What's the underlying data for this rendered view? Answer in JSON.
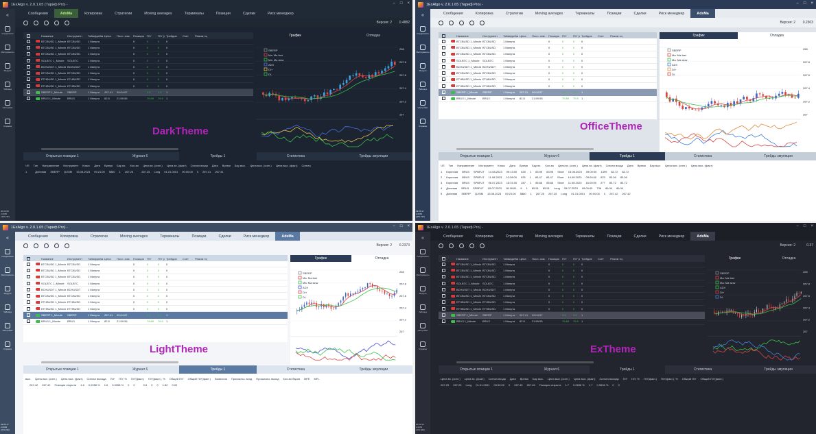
{
  "app_title": "1ExAlgo v. 2.0.1.65 (Тариф Pro) -",
  "window_controls": [
    "–",
    "□",
    "×"
  ],
  "menu": [
    "Сообщения",
    "Копировка",
    "Стратегии",
    "Moving averages",
    "Терминалы",
    "Позиции",
    "Сделки",
    "Риск менеджер",
    "AdsMa"
  ],
  "dark_menu": [
    "Сообщения",
    "AdsMa",
    "Копировка",
    "Стратегии",
    "Moving averages",
    "Терминалы",
    "Позиции",
    "Сделки",
    "Риск менеджер"
  ],
  "sidebar": [
    {
      "label": "Соединения",
      "icon": "link-icon"
    },
    {
      "label": "Инструменты",
      "icon": "tools-icon"
    },
    {
      "label": "Модули",
      "icon": "modules-icon"
    },
    {
      "label": "Таблица",
      "icon": "table-icon"
    },
    {
      "label": "Настройки",
      "icon": "gear-icon"
    },
    {
      "label": "Справка",
      "icon": "help-icon"
    }
  ],
  "themes": {
    "dark": {
      "label": "DarkTheme",
      "version_label": "Версия: 2",
      "version_value": "0.4882",
      "status": [
        "00:34:58",
        "2.0965",
        "(400.195)"
      ]
    },
    "office": {
      "label": "OfficeTheme",
      "version_label": "Версия: 2",
      "version_value": "0.2303",
      "status": [
        "09:06:17",
        "2.0964",
        "(400.195)"
      ]
    },
    "light": {
      "label": "LightTheme",
      "version_label": "Версия: 2",
      "version_value": "0.2373",
      "status": [
        "09:04:17",
        "2.0966",
        "(372.195)"
      ]
    },
    "ex": {
      "label": "ExTheme",
      "version_label": "Версия: 2",
      "version_value": "0.37",
      "status": [
        "00:30:15",
        "2.0956",
        "(372.460)"
      ]
    }
  },
  "table_headers": [
    "Название",
    "Инструмент",
    "Таймфрейм",
    "Цена",
    "Посл. изм.",
    "Позиция",
    "П/У",
    "П/У (факт)",
    "Трейдов",
    "Счет",
    "Режим торгов"
  ],
  "table_rows": [
    {
      "name": "BTCBUSD 1_Minute",
      "inst": "BTCBUSD",
      "tf": "1 Минута",
      "price": "",
      "last": "",
      "pos": "0",
      "pl": "0",
      "plf": "0",
      "tr": "0",
      "on": false
    },
    {
      "name": "BTCBUSD 1_Minute",
      "inst": "BTCBUSD",
      "tf": "1 Минута",
      "price": "",
      "last": "",
      "pos": "0",
      "pl": "0",
      "plf": "0",
      "tr": "0",
      "on": false
    },
    {
      "name": "BTCBUSD 1_Minute",
      "inst": "BTCBUSD",
      "tf": "1 Минута",
      "price": "",
      "last": "",
      "pos": "0",
      "pl": "0",
      "plf": "0",
      "tr": "0",
      "on": false
    },
    {
      "name": "SOLBTC 1_Minute",
      "inst": "SOLBTC",
      "tf": "1 Минута",
      "price": "",
      "last": "",
      "pos": "0",
      "pl": "0",
      "plf": "0",
      "tr": "0",
      "on": false
    },
    {
      "name": "BCHUSDT 1_Minute",
      "inst": "BCHUSDT",
      "tf": "1 Минута",
      "price": "",
      "last": "",
      "pos": "0",
      "pl": "0",
      "plf": "0",
      "tr": "0",
      "on": false
    },
    {
      "name": "BTCBUSD 1_Minute",
      "inst": "BTCBUSD",
      "tf": "1 Минута",
      "price": "",
      "last": "",
      "pos": "0",
      "pl": "0",
      "plf": "0",
      "tr": "0",
      "on": false
    },
    {
      "name": "ETHBUSD 1_Minute",
      "inst": "ETHBUSD",
      "tf": "1 Минута",
      "price": "",
      "last": "",
      "pos": "0",
      "pl": "0",
      "plf": "0",
      "tr": "0",
      "on": false
    },
    {
      "name": "ETHBUSD 1_Minute",
      "inst": "ETHBUSD",
      "tf": "1 Минута",
      "price": "",
      "last": "",
      "pos": "0",
      "pl": "0",
      "plf": "0",
      "tr": "0",
      "on": false
    },
    {
      "name": "SBERP 1_Minute",
      "inst": "SBERP",
      "tf": "1 Минута",
      "price": "267.41",
      "last": "09:04:57",
      "pos": "",
      "pl": "1.2",
      "plf": "1.2",
      "tr": "1",
      "on": true,
      "selected": true
    },
    {
      "name": "BRU3 1_Minute",
      "inst": "BRU3",
      "tf": "1 Минута",
      "price": "82.8",
      "last": "21:59:55",
      "pos": "",
      "pl": "79.89",
      "plf": "79.9",
      "tr": "1",
      "on": true
    }
  ],
  "chart_tabs": [
    "График",
    "Отладка"
  ],
  "chart_legend": [
    "SBERP",
    "Ma: Ma fast",
    "Ma: Ma slow",
    "ADX",
    "DI+",
    "DI-"
  ],
  "chart_axis": [
    "268",
    "267.8",
    "267.6",
    "267.4",
    "267.2",
    "267"
  ],
  "lower_tabs": [
    "Открытые позиции 1",
    "Журнал 6",
    "Трейды 1",
    "Статистика",
    "Трейды эмуляции"
  ],
  "dark_lower_headers": [
    "ЧП",
    "Тип",
    "Направление",
    "Инструмент",
    "Класс",
    "Дата",
    "Время",
    "Бар вх.",
    "Кол-во",
    "Цена вх. (сигн.)",
    "Цена вх. (факт)",
    "Сигнал входа",
    "Дата",
    "Время",
    "Бар вых.",
    "Цена вых. (сигн.)",
    "Цена вых. (факт)",
    "Сигнал"
  ],
  "dark_lower_row": [
    "1",
    "",
    "Длинная",
    "SBERP",
    "QJSIM",
    "15.08.2023",
    "09:21:00",
    "5880",
    "1",
    "267.25",
    "",
    "267.25",
    "Long",
    "01.01.0001",
    "00:00:00",
    "0",
    "267.41",
    "267.41"
  ],
  "office_lower_rows": [
    [
      "1",
      "Короткая",
      "BRU3",
      "SPBFUT",
      "14.08.2023",
      "09:13:00",
      "630",
      "1",
      "83.95",
      "83.95",
      "Short",
      "15.08.2023",
      "09:00:00",
      "1399",
      "83.72",
      "83.72"
    ],
    [
      "2",
      "Короткая",
      "BRU3",
      "SPBFUT",
      "11.08.2023",
      "10:28:00",
      "925",
      "1",
      "83.47",
      "83.47",
      "Short",
      "14.08.2023",
      "09:00:00",
      "623",
      "83.09",
      "83.09"
    ],
    [
      "3",
      "Короткая",
      "BRU3",
      "SPBFUT",
      "06.07.2023",
      "15:31:00",
      "287",
      "1",
      "85.65",
      "85.65",
      "Short",
      "11.08.2023",
      "16:00:00",
      "277",
      "83.72",
      "83.72"
    ],
    [
      "4",
      "Длинная",
      "BRU3",
      "SPBFUT",
      "05.07.2023",
      "18:18:00",
      "6",
      "1",
      "85.51",
      "85.51",
      "Long",
      "05.07.2023",
      "09:00:00",
      "736",
      "86.34",
      "86.34"
    ],
    [
      "5",
      "Длинная",
      "SBERP",
      "QJSIM",
      "15.08.2023",
      "09:21:00",
      "5880",
      "1",
      "267.25",
      "267.25",
      "Long",
      "01.01.0001",
      "00:00:00",
      "0",
      "267.42",
      "267.42"
    ]
  ],
  "light_lower_headers": [
    "вых.",
    "Цена вых. (сигн.)",
    "Цена вых. (факт)",
    "Сигнал выхода",
    "П/У",
    "П/У, %",
    "П/У(факт.)",
    "П/У(факт.), %",
    "Общий П/У",
    "Общий П/У(факт.)",
    "Комиссия",
    "Проскальз. вход",
    "Проскальз. выход",
    "Кол-во баров",
    "MFE",
    "MFL"
  ],
  "light_lower_row": [
    "",
    "267.42",
    "267.42",
    "Позиция открыта",
    "1.6",
    "0.0058 %",
    "1.6",
    "0.0058 %",
    "0",
    "0",
    "",
    "0.6",
    "0",
    "0",
    "1.82",
    "0.00"
  ],
  "ex_lower_headers": [
    "Цена вх. (сигн.)",
    "Цена вх. (факт)",
    "Сигнал входа",
    "Дата",
    "Время",
    "Бар вых.",
    "Цена вых. (сигн.)",
    "Цена вых. (факт)",
    "Сигнал выхода",
    "П/У",
    "П/У, %",
    "П/У(факт.)",
    "П/У(факт.), %",
    "Общий П/У",
    "Общий П/У(факт.)"
  ],
  "ex_lower_row": [
    "267.25",
    "267.25",
    "Long",
    "01.01.0001",
    "00:00:00",
    "0",
    "267.45",
    "267.45",
    "Позиция открыта",
    "1.7",
    "0.0636 %",
    "1.7",
    "0.0636 %",
    "0",
    "0"
  ],
  "colors": {
    "accent_purple": "#b026b8",
    "toggle_on": "#3bbf4a",
    "toggle_off": "#d63a3a",
    "bull": "#3f7fd6",
    "bear": "#d6453f"
  }
}
